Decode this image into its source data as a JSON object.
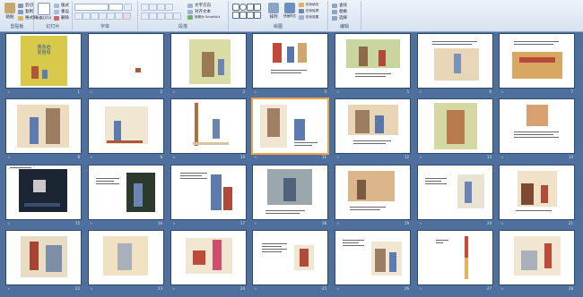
{
  "ribbon": {
    "groups": [
      "剪贴板",
      "幻灯片",
      "字体",
      "段落",
      "绘图",
      "编辑"
    ],
    "clipboard": {
      "paste": "粘贴",
      "cut": "剪切",
      "copy": "复制",
      "format_painter": "格式刷"
    },
    "slides": {
      "new_slide": "新建幻灯片",
      "layout": "版式",
      "reset": "重设",
      "delete": "删除"
    },
    "paragraph": {
      "text_direction": "文字方向",
      "align_text": "对齐文本",
      "smartart": "转换为 SmartArt"
    },
    "drawing": {
      "arrange": "排列",
      "quick_styles": "快速样式",
      "shape_fill": "形状填充",
      "shape_outline": "形状轮廓",
      "shape_effects": "形状效果"
    },
    "editing": {
      "find": "查找",
      "replace": "替换",
      "select": "选择"
    }
  },
  "title_slide": {
    "title": "我永远\n爱祖母"
  },
  "slides": [
    {
      "n": "1",
      "kind": "title"
    },
    {
      "n": "2",
      "kind": "tiny"
    },
    {
      "n": "3",
      "kind": "tree"
    },
    {
      "n": "4",
      "kind": "figures"
    },
    {
      "n": "5",
      "kind": "garden"
    },
    {
      "n": "6",
      "kind": "room"
    },
    {
      "n": "7",
      "kind": "shelf"
    },
    {
      "n": "8",
      "kind": "duo"
    },
    {
      "n": "9",
      "kind": "child"
    },
    {
      "n": "10",
      "kind": "door"
    },
    {
      "n": "11",
      "kind": "duo-small",
      "selected": true
    },
    {
      "n": "12",
      "kind": "sofa"
    },
    {
      "n": "13",
      "kind": "frame"
    },
    {
      "n": "14",
      "kind": "portrait"
    },
    {
      "n": "15",
      "kind": "night"
    },
    {
      "n": "16",
      "kind": "dark"
    },
    {
      "n": "17",
      "kind": "family"
    },
    {
      "n": "18",
      "kind": "doorway"
    },
    {
      "n": "19",
      "kind": "stairs"
    },
    {
      "n": "20",
      "kind": "window"
    },
    {
      "n": "21",
      "kind": "cabinet"
    },
    {
      "n": "22",
      "kind": "grandpa"
    },
    {
      "n": "23",
      "kind": "chair"
    },
    {
      "n": "24",
      "kind": "play"
    },
    {
      "n": "25",
      "kind": "text"
    },
    {
      "n": "26",
      "kind": "pair"
    },
    {
      "n": "27",
      "kind": "pole"
    },
    {
      "n": "28",
      "kind": "rest"
    }
  ],
  "colors": {
    "selection": "#f0a24b",
    "workspace": "#4f6f9c",
    "ribbon": "#dce6f2"
  }
}
